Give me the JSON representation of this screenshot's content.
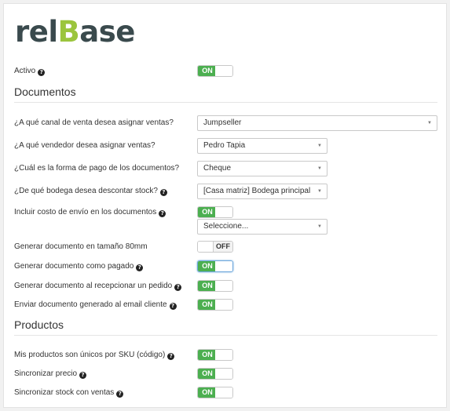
{
  "brand": {
    "logo_part1": "rel",
    "logo_part2": "B",
    "logo_part3": "ase"
  },
  "activo": {
    "label": "Activo",
    "toggle": "ON"
  },
  "documentos": {
    "title": "Documentos",
    "canal": {
      "label": "¿A qué canal de venta desea asignar ventas?",
      "value": "Jumpseller"
    },
    "vendedor": {
      "label": "¿A qué vendedor desea asignar ventas?",
      "value": "Pedro Tapia"
    },
    "forma_pago": {
      "label": "¿Cuál es la forma de pago de los documentos?",
      "value": "Cheque"
    },
    "bodega": {
      "label": "¿De qué bodega desea descontar stock?",
      "value": "[Casa matriz] Bodega principal"
    },
    "costo_envio": {
      "label": "Incluir costo de envío en los documentos",
      "toggle": "ON",
      "select_value": "Seleccione..."
    },
    "tamano_80mm": {
      "label": "Generar documento en tamaño 80mm",
      "toggle": "OFF"
    },
    "como_pagado": {
      "label": "Generar documento como pagado",
      "toggle": "ON"
    },
    "al_recepcionar": {
      "label": "Generar documento al recepcionar un pedido",
      "toggle": "ON"
    },
    "enviar_email": {
      "label": "Enviar documento generado al email cliente",
      "toggle": "ON"
    }
  },
  "productos": {
    "title": "Productos",
    "sku_unicos": {
      "label": "Mis productos son únicos por SKU (código)",
      "toggle": "ON"
    },
    "sinc_precio": {
      "label": "Sincronizar precio",
      "toggle": "ON"
    },
    "sinc_stock": {
      "label": "Sincronizar stock con ventas",
      "toggle": "ON"
    }
  },
  "colors": {
    "toggle_on": "#4caf50",
    "logo_dark": "#3a4a4d",
    "logo_accent": "#9bc53d"
  },
  "icons": {
    "help": "question-circle-icon",
    "caret": "caret-down-icon"
  }
}
